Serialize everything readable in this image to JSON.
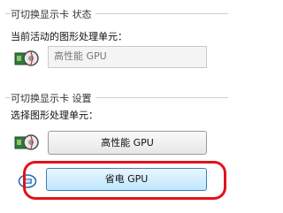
{
  "status_group": {
    "title": "可切换显示卡 状态",
    "current_label": "当前活动的图形处理单元：",
    "current_value": "高性能 GPU"
  },
  "settings_group": {
    "title": "可切换显示卡 设置",
    "select_label": "选择图形处理单元：",
    "high_perf_button": "高性能 GPU",
    "power_saving_button": "省电 GPU"
  },
  "icons": {
    "gpu_card": "graphics-card-icon",
    "intel_chip": "intel-chip-icon"
  },
  "colors": {
    "highlight": "#e0141a",
    "selected_button": "#bee6fd"
  }
}
